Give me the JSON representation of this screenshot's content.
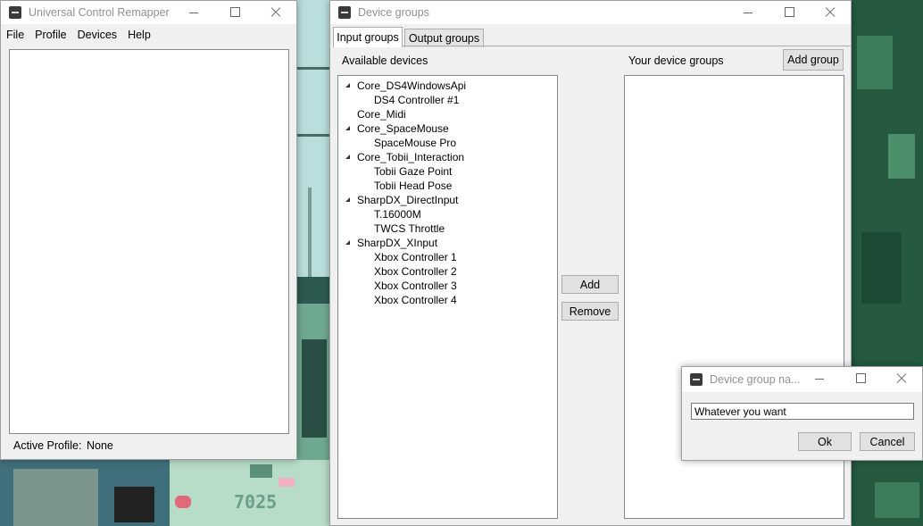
{
  "main_window": {
    "title": "Universal Control Remapper",
    "menu": [
      "File",
      "Profile",
      "Devices",
      "Help"
    ],
    "status_label": "Active Profile:",
    "status_value": "None"
  },
  "device_groups_window": {
    "title": "Device groups",
    "tabs": [
      "Input groups",
      "Output groups"
    ],
    "active_tab": "Input groups",
    "available_label": "Available devices",
    "your_groups_label": "Your device groups",
    "add_group_button": "Add group",
    "add_button": "Add",
    "remove_button": "Remove",
    "providers": [
      {
        "name": "Core_DS4WindowsApi",
        "devices": [
          "DS4 Controller #1"
        ]
      },
      {
        "name": "Core_Midi",
        "devices": []
      },
      {
        "name": "Core_SpaceMouse",
        "devices": [
          "SpaceMouse Pro"
        ]
      },
      {
        "name": "Core_Tobii_Interaction",
        "devices": [
          "Tobii Gaze Point",
          "Tobii Head Pose"
        ]
      },
      {
        "name": "SharpDX_DirectInput",
        "devices": [
          "T.16000M",
          "TWCS Throttle"
        ]
      },
      {
        "name": "SharpDX_XInput",
        "devices": [
          "Xbox Controller 1",
          "Xbox Controller 2",
          "Xbox Controller 3",
          "Xbox Controller 4"
        ]
      }
    ]
  },
  "name_dialog": {
    "title": "Device group na...",
    "input_value": "Whatever you want",
    "ok_button": "Ok",
    "cancel_button": "Cancel"
  },
  "desktop_wallpaper": {
    "counter_text": "7025"
  },
  "colors": {
    "window_bg": "#f0f0f0",
    "title_text": "#909090",
    "wallpaper_green": "#2f5f4a"
  }
}
